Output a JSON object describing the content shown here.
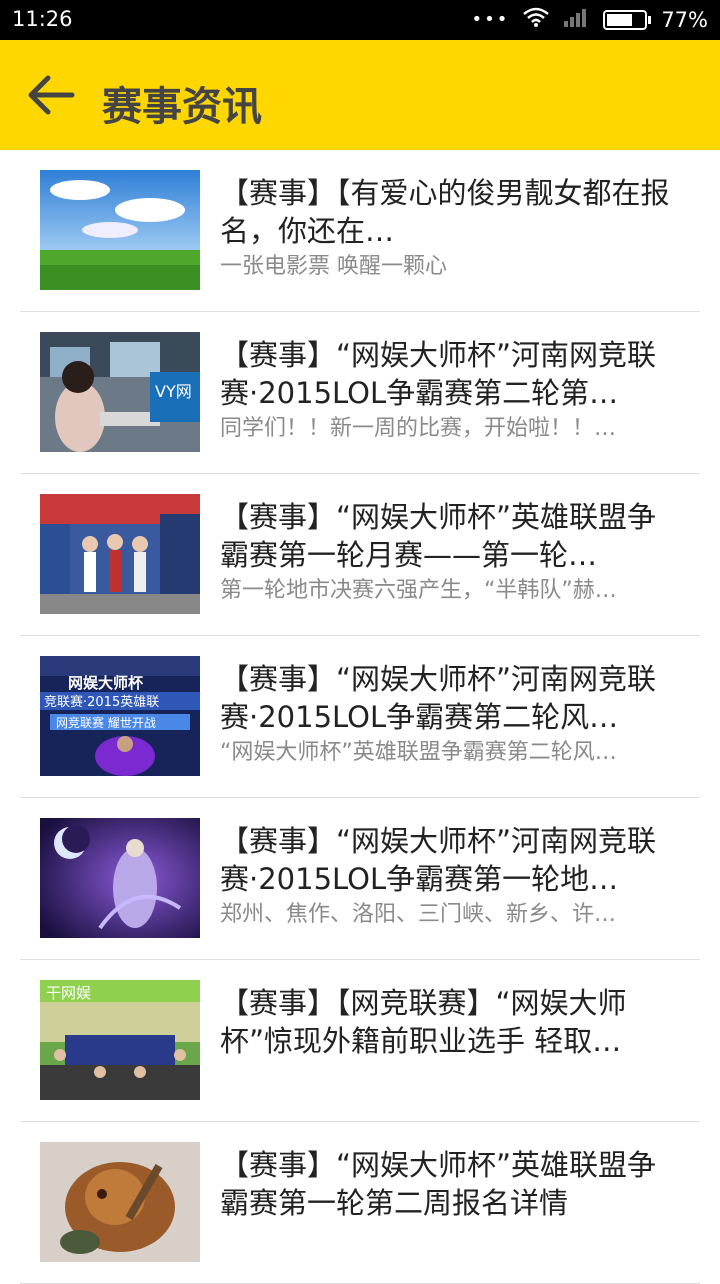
{
  "status_bar": {
    "time": "11:26",
    "battery": "77%",
    "battery_level": 0.77
  },
  "app_bar": {
    "title": "赛事资讯"
  },
  "news": [
    {
      "headline": "【赛事】【有爱心的俊男靓女都在报名，你还在…",
      "summary": "一张电影票 唤醒一颗心",
      "image": "sky-grass"
    },
    {
      "headline": "【赛事】“网娱大师杯”河南网竞联赛·2015LOL争霸赛第二轮第…",
      "summary": "同学们！！新一周的比赛，开始啦！！…",
      "image": "internet-cafe"
    },
    {
      "headline": "【赛事】“网娱大师杯”英雄联盟争霸赛第一轮月赛——第一轮…",
      "summary": "第一轮地市决赛六强产生，“半韩队”赫…",
      "image": "event-girls"
    },
    {
      "headline": "【赛事】“网娱大师杯”河南网竞联赛·2015LOL争霸赛第二轮风…",
      "summary": "“网娱大师杯”英雄联盟争霸赛第二轮风…",
      "image": "poster-banner"
    },
    {
      "headline": "【赛事】“网娱大师杯”河南网竞联赛·2015LOL争霸赛第一轮地…",
      "summary": "郑州、焦作、洛阳、三门峡、新乡、许…",
      "image": "moon-champion"
    },
    {
      "headline": "【赛事】【网竞联赛】“网娱大师杯”惊现外籍前职业选手 轻取…",
      "summary": "",
      "image": "group-photo"
    },
    {
      "headline": "【赛事】“网娱大师杯”英雄联盟争霸赛第一轮第二周报名详情",
      "summary": "",
      "image": "warrior-art"
    }
  ]
}
